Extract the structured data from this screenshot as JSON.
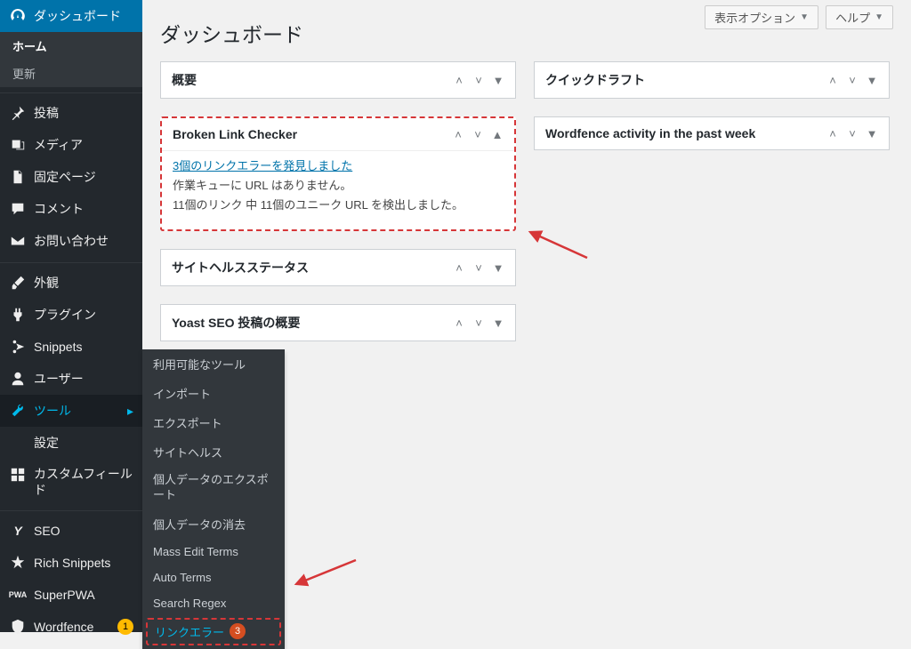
{
  "page_title": "ダッシュボード",
  "top_buttons": {
    "screen_options": "表示オプション",
    "help": "ヘルプ"
  },
  "sidebar": {
    "dashboard": {
      "label": "ダッシュボード",
      "home": "ホーム",
      "update": "更新"
    },
    "items": [
      {
        "label": "投稿",
        "icon": "pin"
      },
      {
        "label": "メディア",
        "icon": "media"
      },
      {
        "label": "固定ページ",
        "icon": "page"
      },
      {
        "label": "コメント",
        "icon": "comment"
      },
      {
        "label": "お問い合わせ",
        "icon": "mail"
      }
    ],
    "items2": [
      {
        "label": "外観",
        "icon": "brush"
      },
      {
        "label": "プラグイン",
        "icon": "plugin"
      },
      {
        "label": "Snippets",
        "icon": "scissors"
      },
      {
        "label": "ユーザー",
        "icon": "user"
      },
      {
        "label": "ツール",
        "icon": "wrench",
        "active": true
      },
      {
        "label": "設定",
        "icon": "sliders"
      },
      {
        "label": "カスタムフィールド",
        "icon": "grid"
      }
    ],
    "items3": [
      {
        "label": "SEO",
        "icon": "y"
      },
      {
        "label": "Rich Snippets",
        "icon": "star"
      },
      {
        "label": "SuperPWA",
        "icon": "pwa"
      },
      {
        "label": "Wordfence",
        "icon": "wf",
        "badge": "1"
      }
    ]
  },
  "tools_submenu": [
    "利用可能なツール",
    "インポート",
    "エクスポート",
    "サイトヘルス",
    "個人データのエクスポート",
    "個人データの消去",
    "Mass Edit Terms",
    "Auto Terms",
    "Search Regex"
  ],
  "tools_submenu_hl": {
    "label": "リンクエラー",
    "badge": "3"
  },
  "boxes_left": [
    {
      "title": "概要"
    },
    {
      "title": "Broken Link Checker",
      "link": "3個のリンクエラーを発見しました",
      "body1": "作業キューに URL はありません。",
      "body2": "11個のリンク 中 11個のユニーク URL を検出しました。",
      "highlight": true
    },
    {
      "title": "サイトヘルスステータス"
    },
    {
      "title": "Yoast SEO 投稿の概要"
    }
  ],
  "boxes_right": [
    {
      "title": "クイックドラフト"
    },
    {
      "title": "Wordfence activity in the past week"
    }
  ]
}
